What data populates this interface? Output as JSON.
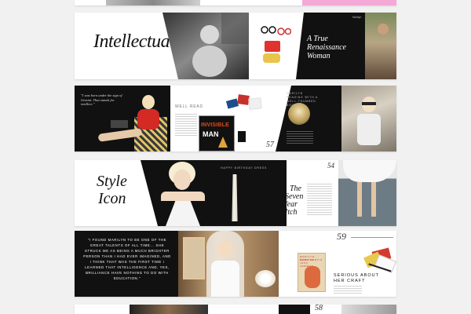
{
  "spreads": {
    "intellectual": {
      "title": "Intellectual",
      "side_title": "A True Renaissance Woman",
      "side_kicker": "Marilyn"
    },
    "well_read": {
      "quote": "\"I was born under the sign of Gemini. That stands for intellect.\"",
      "heading": "WELL READ",
      "book_title_line1": "INVISIBLE",
      "book_title_line2": "MAN",
      "page_number": "57",
      "caption": "Marilyn reading with a well-thumbed book"
    },
    "style_icon": {
      "title_line1": "Style",
      "title_line2": "Icon",
      "dress_caption": "HAPPY BIRTHDAY DRESS",
      "film_line1": "The",
      "film_line2": "Seven",
      "film_line3": "Year",
      "film_line4": "Itch",
      "page_number": "54"
    },
    "quote_spread": {
      "quote": "\"I FOUND MARILYN TO BE ONE OF THE GREAT TALENTS OF ALL TIME... SHE STRUCK ME AS BEING A MUCH BRIGHTER PERSON THAN I HAD EVER IMAGINED, AND I THINK THAT WAS THE FIRST TIME I LEARNED THAT INTELLIGENCE AND, YES, BRILLIANCE HAVE NOTHING TO DO WITH EDUCATION.\"",
      "page_number": "59",
      "heading_line1": "SERIOUS ABOUT",
      "heading_line2": "HER CRAFT",
      "poster_line1": "MARILYN MONROE",
      "poster_line2": "TONY CURTIS",
      "poster_line3": "JACK LEMMON"
    },
    "bottom": {
      "page_number": "58"
    }
  },
  "colors": {
    "background": "#f1f1f1",
    "black": "#111111",
    "red": "#d42a24",
    "pink": "#f4a9d6"
  }
}
